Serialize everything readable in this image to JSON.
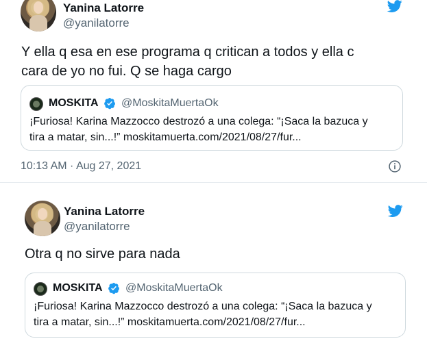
{
  "colors": {
    "twitter_blue": "#1d9bf0",
    "verified_blue": "#1d9bf0",
    "secondary_text": "#536471",
    "border": "#cfd9de"
  },
  "tweets": [
    {
      "author_name": "Yanina Latorre",
      "author_handle": "@yanilatorre",
      "text": "Y ella q esa en ese programa q critican a todos y ella c\ncara de yo no fui. Q se haga cargo",
      "quote": {
        "name": "MOSKITA",
        "handle": "@MoskitaMuertaOk",
        "text": "¡Furiosa! Karina Mazzocco destrozó a una colega: “¡Saca la bazuca y\ntira a matar, sin...!” moskitamuerta.com/2021/08/27/fur..."
      },
      "timestamp": "10:13 AM · Aug 27, 2021",
      "icons": [
        "twitter-bird-icon",
        "info-icon"
      ]
    },
    {
      "author_name": "Yanina Latorre",
      "author_handle": "@yanilatorre",
      "text": "Otra q no sirve para nada",
      "quote": {
        "name": "MOSKITA",
        "handle": "@MoskitaMuertaOk",
        "text": "¡Furiosa! Karina Mazzocco destrozó a una colega: “¡Saca la bazuca y\ntira a matar, sin...!” moskitamuerta.com/2021/08/27/fur..."
      },
      "icons": [
        "twitter-bird-icon"
      ]
    }
  ]
}
